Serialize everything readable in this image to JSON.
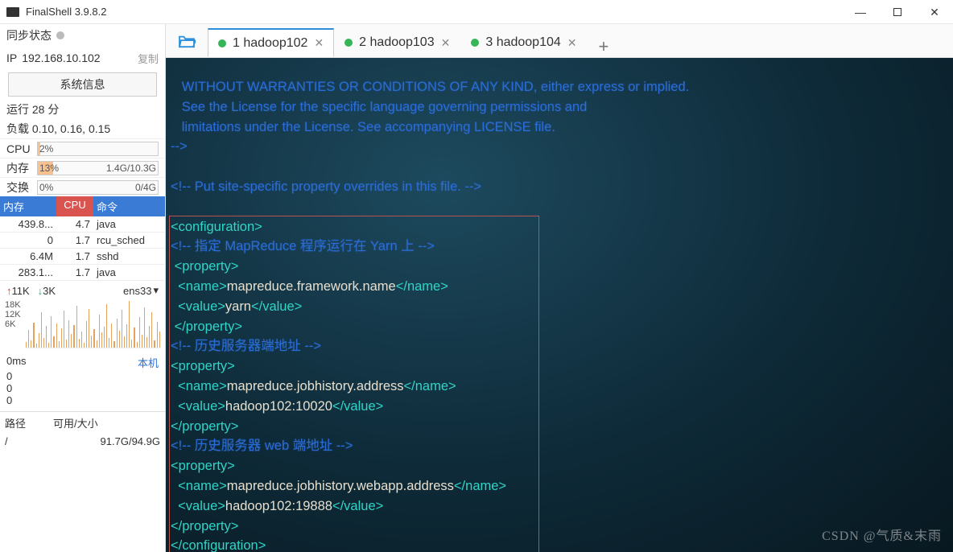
{
  "app": {
    "title": "FinalShell 3.9.8.2"
  },
  "window_controls": {
    "min": "—",
    "close": "✕"
  },
  "sidebar": {
    "sync_label": "同步状态",
    "ip_label": "IP",
    "ip_value": "192.168.10.102",
    "copy": "复制",
    "sys_info_btn": "系统信息",
    "uptime": "运行 28 分",
    "load": "负载 0.10, 0.16, 0.15",
    "cpu_label": "CPU",
    "cpu_pct": "2%",
    "mem_label": "内存",
    "mem_pct": "13%",
    "mem_detail": "1.4G/10.3G",
    "swap_label": "交换",
    "swap_pct": "0%",
    "swap_detail": "0/4G",
    "proc_headers": {
      "mem": "内存",
      "cpu": "CPU",
      "cmd": "命令"
    },
    "procs": [
      {
        "mem": "439.8...",
        "cpu": "4.7",
        "cmd": "java"
      },
      {
        "mem": "0",
        "cpu": "1.7",
        "cmd": "rcu_sched"
      },
      {
        "mem": "6.4M",
        "cpu": "1.7",
        "cmd": "sshd"
      },
      {
        "mem": "283.1...",
        "cpu": "1.7",
        "cmd": "java"
      }
    ],
    "net_up": "11K",
    "net_dn": "3K",
    "iface": "ens33",
    "ylabels": [
      "18K",
      "12K",
      "6K"
    ],
    "ping_ms": "0ms",
    "ping_host": "本机",
    "ping_vals": [
      "0",
      "0",
      "0"
    ],
    "path_hdr_path": "路径",
    "path_hdr_size": "可用/大小",
    "path_root": "/",
    "path_size": "91.7G/94.9G"
  },
  "tabs": {
    "items": [
      {
        "label": "1 hadoop102",
        "active": true
      },
      {
        "label": "2 hadoop103",
        "active": false
      },
      {
        "label": "3 hadoop104",
        "active": false
      }
    ],
    "add": "+"
  },
  "terminal": {
    "pre_lines": [
      "   WITHOUT WARRANTIES OR CONDITIONS OF ANY KIND, either express or implied.",
      "   See the License for the specific language governing permissions and",
      "   limitations under the License. See accompanying LICENSE file.",
      "-->",
      "",
      "<!-- Put site-specific property overrides in this file. -->",
      ""
    ],
    "config": [
      {
        "type": "tag",
        "text": "<configuration>"
      },
      {
        "type": "cmt",
        "text": "<!-- 指定 MapReduce 程序运行在 Yarn 上 -->"
      },
      {
        "type": "tag",
        "text": " <property>"
      },
      {
        "type": "mix",
        "parts": [
          {
            "t": "tag",
            "v": "  <name>"
          },
          {
            "t": "txt",
            "v": "mapreduce.framework.name"
          },
          {
            "t": "tag",
            "v": "</name>"
          }
        ]
      },
      {
        "type": "mix",
        "parts": [
          {
            "t": "tag",
            "v": "  <value>"
          },
          {
            "t": "txt",
            "v": "yarn"
          },
          {
            "t": "tag",
            "v": "</value>"
          }
        ]
      },
      {
        "type": "tag",
        "text": " </property>"
      },
      {
        "type": "cmt",
        "text": "<!-- 历史服务器端地址 -->"
      },
      {
        "type": "tag",
        "text": "<property>"
      },
      {
        "type": "mix",
        "parts": [
          {
            "t": "tag",
            "v": "  <name>"
          },
          {
            "t": "txt",
            "v": "mapreduce.jobhistory.address"
          },
          {
            "t": "tag",
            "v": "</name>"
          }
        ]
      },
      {
        "type": "mix",
        "parts": [
          {
            "t": "tag",
            "v": "  <value>"
          },
          {
            "t": "txt",
            "v": "hadoop102:10020"
          },
          {
            "t": "tag",
            "v": "</value>"
          }
        ]
      },
      {
        "type": "tag",
        "text": "</property>"
      },
      {
        "type": "cmt",
        "text": "<!-- 历史服务器 web 端地址 -->"
      },
      {
        "type": "tag",
        "text": "<property>"
      },
      {
        "type": "mix",
        "parts": [
          {
            "t": "tag",
            "v": "  <name>"
          },
          {
            "t": "txt",
            "v": "mapreduce.jobhistory.webapp.address"
          },
          {
            "t": "tag",
            "v": "</name>"
          }
        ]
      },
      {
        "type": "mix",
        "parts": [
          {
            "t": "tag",
            "v": "  <value>"
          },
          {
            "t": "txt",
            "v": "hadoop102:19888"
          },
          {
            "t": "tag",
            "v": "</value>"
          }
        ]
      },
      {
        "type": "tag",
        "text": "</property>"
      },
      {
        "type": "tag",
        "text": "</configuration>"
      }
    ]
  },
  "watermark": "CSDN @气质&末雨",
  "spark_heights": [
    7,
    22,
    9,
    31,
    5,
    18,
    44,
    12,
    27,
    6,
    39,
    14,
    30,
    8,
    24,
    46,
    10,
    34,
    17,
    28,
    52,
    11,
    20,
    6,
    33,
    48,
    15,
    23,
    9,
    41,
    19,
    26,
    54,
    12,
    30,
    8,
    36,
    21,
    47,
    14,
    29,
    58,
    10,
    25,
    7,
    38,
    16,
    50,
    13,
    27,
    44,
    9,
    32,
    20
  ],
  "colors": {
    "spark": "#e6a25c"
  }
}
